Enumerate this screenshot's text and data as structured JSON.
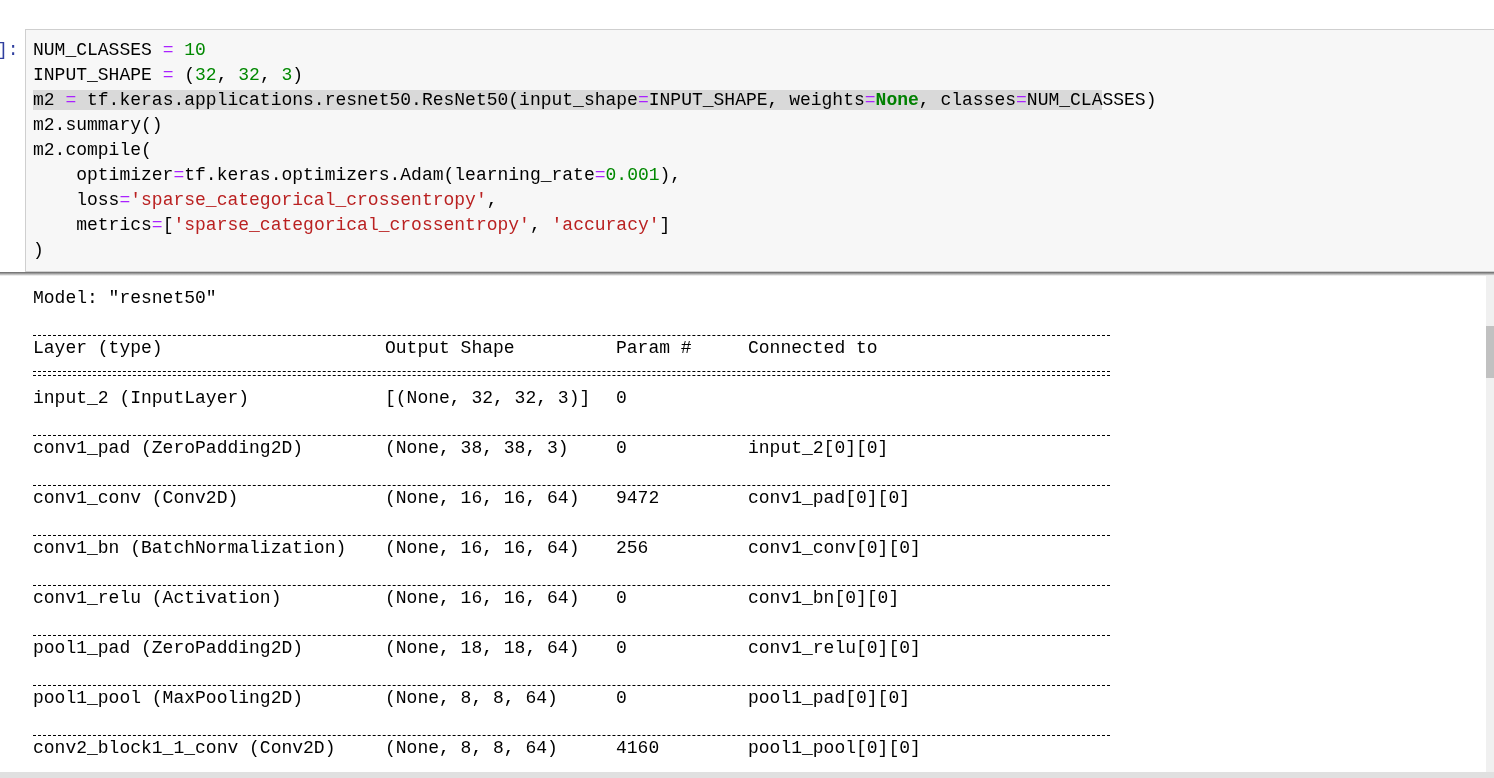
{
  "prompt": "]:",
  "code_lines": [
    [
      {
        "text": "NUM_CLASSES ",
        "kind": "plain"
      },
      {
        "text": "=",
        "kind": "op"
      },
      {
        "text": " 10",
        "kind": "num"
      }
    ],
    [
      {
        "text": "INPUT_SHAPE ",
        "kind": "plain"
      },
      {
        "text": "=",
        "kind": "op"
      },
      {
        "text": " (",
        "kind": "plain"
      },
      {
        "text": "32",
        "kind": "num"
      },
      {
        "text": ", ",
        "kind": "plain"
      },
      {
        "text": "32",
        "kind": "num"
      },
      {
        "text": ", ",
        "kind": "plain"
      },
      {
        "text": "3",
        "kind": "num"
      },
      {
        "text": ")",
        "kind": "plain"
      }
    ],
    [
      {
        "text": "m2 ",
        "kind": "plain",
        "selected": true
      },
      {
        "text": "=",
        "kind": "op",
        "selected": true
      },
      {
        "text": " tf.keras.applications.resnet50.ResNet50(input_shape",
        "kind": "plain",
        "selected": true
      },
      {
        "text": "=",
        "kind": "op",
        "selected": true
      },
      {
        "text": "INPUT_SHAPE, weights",
        "kind": "plain",
        "selected": true
      },
      {
        "text": "=",
        "kind": "op",
        "selected": true
      },
      {
        "text": "None",
        "kind": "kw",
        "selected": true
      },
      {
        "text": ", classes",
        "kind": "plain",
        "selected": true
      },
      {
        "text": "=",
        "kind": "op",
        "selected": true
      },
      {
        "text": "NUM_CLA",
        "kind": "plain",
        "selected": true
      },
      {
        "text": "SSES)",
        "kind": "plain",
        "selected": false
      }
    ],
    [
      {
        "text": "m2.summary()",
        "kind": "plain"
      }
    ],
    [
      {
        "text": "m2.compile(",
        "kind": "plain"
      }
    ],
    [
      {
        "text": "    optimizer",
        "kind": "plain"
      },
      {
        "text": "=",
        "kind": "op"
      },
      {
        "text": "tf.keras.optimizers.Adam(learning_rate",
        "kind": "plain"
      },
      {
        "text": "=",
        "kind": "op"
      },
      {
        "text": "0.001",
        "kind": "num"
      },
      {
        "text": "),",
        "kind": "plain"
      }
    ],
    [
      {
        "text": "    loss",
        "kind": "plain"
      },
      {
        "text": "=",
        "kind": "op"
      },
      {
        "text": "'sparse_categorical_crossentropy'",
        "kind": "str"
      },
      {
        "text": ",",
        "kind": "plain"
      }
    ],
    [
      {
        "text": "    metrics",
        "kind": "plain"
      },
      {
        "text": "=",
        "kind": "op"
      },
      {
        "text": "[",
        "kind": "plain"
      },
      {
        "text": "'sparse_categorical_crossentropy'",
        "kind": "str"
      },
      {
        "text": ", ",
        "kind": "plain"
      },
      {
        "text": "'accuracy'",
        "kind": "str"
      },
      {
        "text": "]",
        "kind": "plain"
      }
    ],
    [
      {
        "text": ")",
        "kind": "plain"
      }
    ]
  ],
  "output": {
    "title": "Model: \"resnet50\"",
    "columns": [
      "Layer (type)",
      "Output Shape",
      "Param #",
      "Connected to"
    ],
    "rows": [
      [
        "input_2 (InputLayer)",
        "[(None, 32, 32, 3)]",
        "0"
      ],
      [
        "conv1_pad (ZeroPadding2D)",
        "(None, 38, 38, 3)",
        "0",
        "input_2[0][0]"
      ],
      [
        "conv1_conv (Conv2D)",
        "(None, 16, 16, 64)",
        "9472",
        "conv1_pad[0][0]"
      ],
      [
        "conv1_bn (BatchNormalization)",
        "(None, 16, 16, 64)",
        "256",
        "conv1_conv[0][0]"
      ],
      [
        "conv1_relu (Activation)",
        "(None, 16, 16, 64)",
        "0",
        "conv1_bn[0][0]"
      ],
      [
        "pool1_pad (ZeroPadding2D)",
        "(None, 18, 18, 64)",
        "0",
        "conv1_relu[0][0]"
      ],
      [
        "pool1_pool (MaxPooling2D)",
        "(None, 8, 8, 64)",
        "0",
        "pool1_pad[0][0]"
      ],
      [
        "conv2_block1_1_conv (Conv2D)",
        "(None, 8, 8, 64)",
        "4160",
        "pool1_pool[0][0]"
      ]
    ]
  }
}
